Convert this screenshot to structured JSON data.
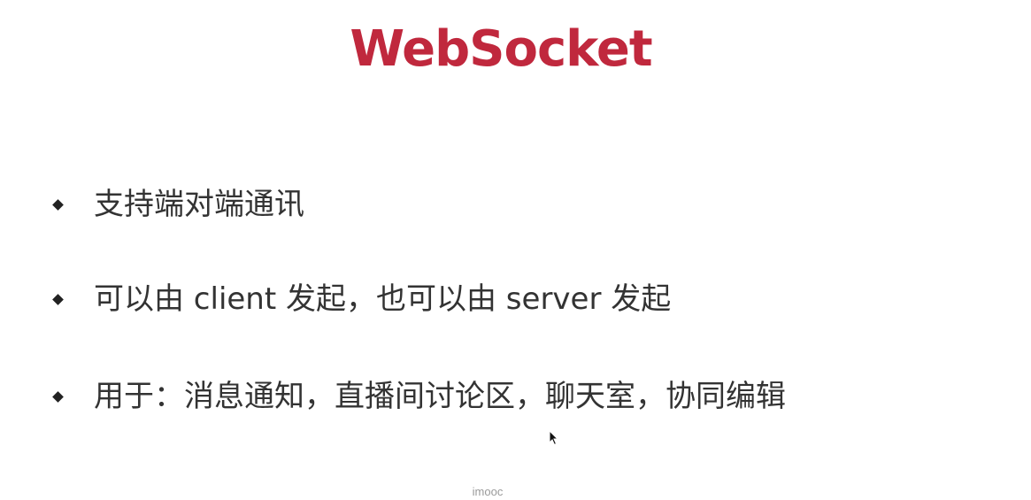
{
  "slide": {
    "title": "WebSocket",
    "bullets": [
      {
        "text": "支持端对端通讯"
      },
      {
        "text": "可以由 client 发起，也可以由 server 发起"
      },
      {
        "text": "用于：消息通知，直播间讨论区，聊天室，协同编辑"
      }
    ],
    "watermark": "imooc"
  },
  "colors": {
    "title": "#c0283d",
    "text": "#333333",
    "bullet": "#222222",
    "watermark": "#9a9a9a",
    "background": "#ffffff"
  },
  "icons": {
    "bullet": "diamond-bullet-icon",
    "cursor": "mouse-cursor-icon"
  }
}
